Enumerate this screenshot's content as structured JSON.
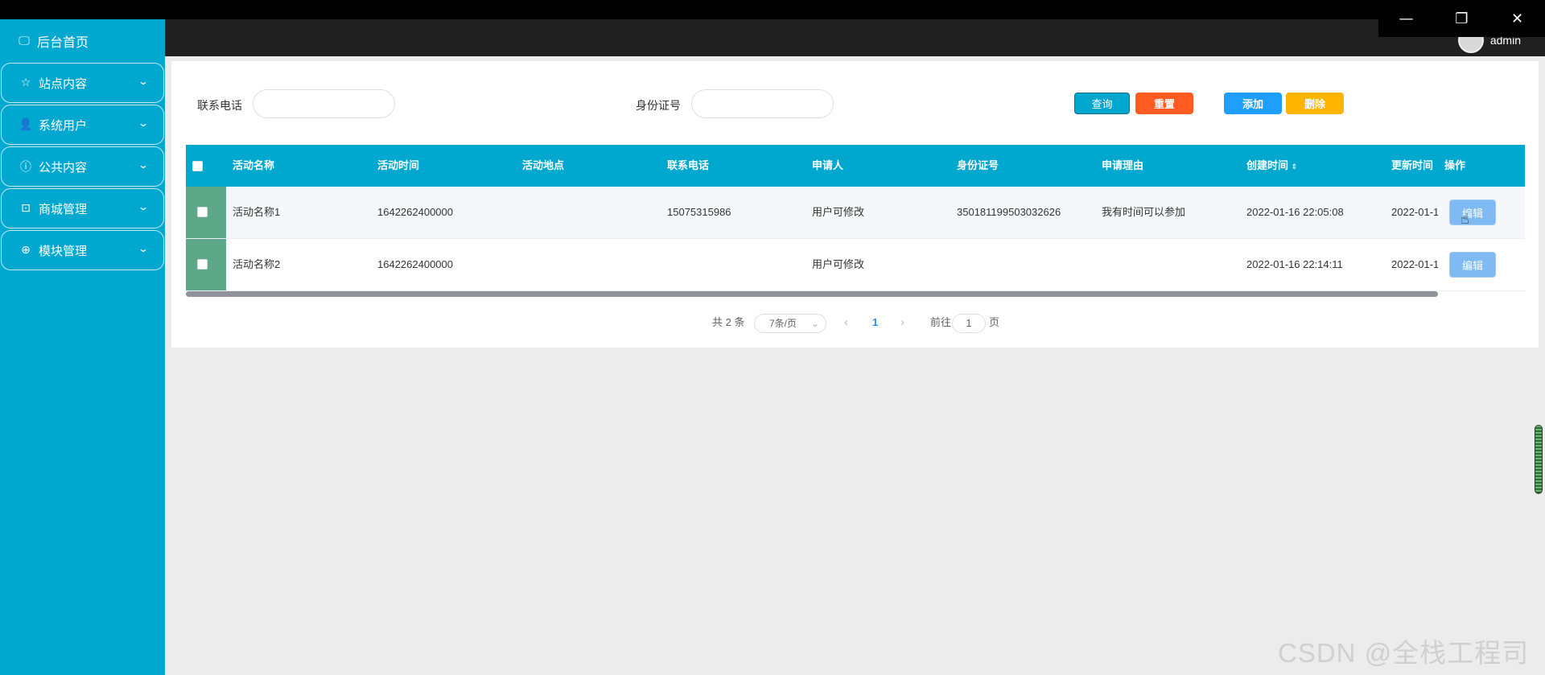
{
  "window": {
    "minimize": "—",
    "restore": "❐",
    "close": "✕"
  },
  "sidebar": {
    "home": {
      "icon": "monitor-icon",
      "label": "后台首页"
    },
    "items": [
      {
        "icon": "star-icon",
        "label": "站点内容"
      },
      {
        "icon": "user-icon",
        "label": "系统用户"
      },
      {
        "icon": "info-icon",
        "label": "公共内容"
      },
      {
        "icon": "bag-icon",
        "label": "商城管理"
      },
      {
        "icon": "plus-circle-icon",
        "label": "模块管理"
      }
    ]
  },
  "header": {
    "username": "admin"
  },
  "search": {
    "phone_label": "联系电话",
    "phone_value": "",
    "id_label": "身份证号",
    "id_value": "",
    "query_label": "查询",
    "reset_label": "重置",
    "add_label": "添加",
    "delete_label": "删除"
  },
  "colors": {
    "accent": "#00a7cf",
    "header": "#202020",
    "query": "#00a7cf",
    "reset": "#ff5a1f",
    "add": "#1e9fff",
    "delete": "#ffb400",
    "select_cell": "#5ea88a",
    "edit": "#7fbbf2"
  },
  "table": {
    "headers": [
      "活动名称",
      "活动时间",
      "活动地点",
      "联系电话",
      "申请人",
      "身份证号",
      "申请理由",
      "创建时间",
      "更新时间",
      "操作"
    ],
    "sort_icon": "sort-caret-icon",
    "rows": [
      {
        "name": "活动名称1",
        "time": "1642262400000",
        "location": "",
        "phone": "15075315986",
        "applicant": "用户可修改",
        "id_no": "350181199503032626",
        "reason": "我有时间可以参加",
        "created": "2022-01-16 22:05:08",
        "updated": "2022-01-1",
        "edit": "编辑"
      },
      {
        "name": "活动名称2",
        "time": "1642262400000",
        "location": "",
        "phone": "",
        "applicant": "用户可修改",
        "id_no": "",
        "reason": "",
        "created": "2022-01-16 22:14:11",
        "updated": "2022-01-1",
        "edit": "编辑"
      }
    ]
  },
  "pagination": {
    "total": "共 2 条",
    "page_size": "7条/页",
    "prev": "‹",
    "current": "1",
    "next": "›",
    "goto_label": "前往",
    "goto_value": "1",
    "page_suffix": "页"
  },
  "watermark": "CSDN @全栈工程司"
}
